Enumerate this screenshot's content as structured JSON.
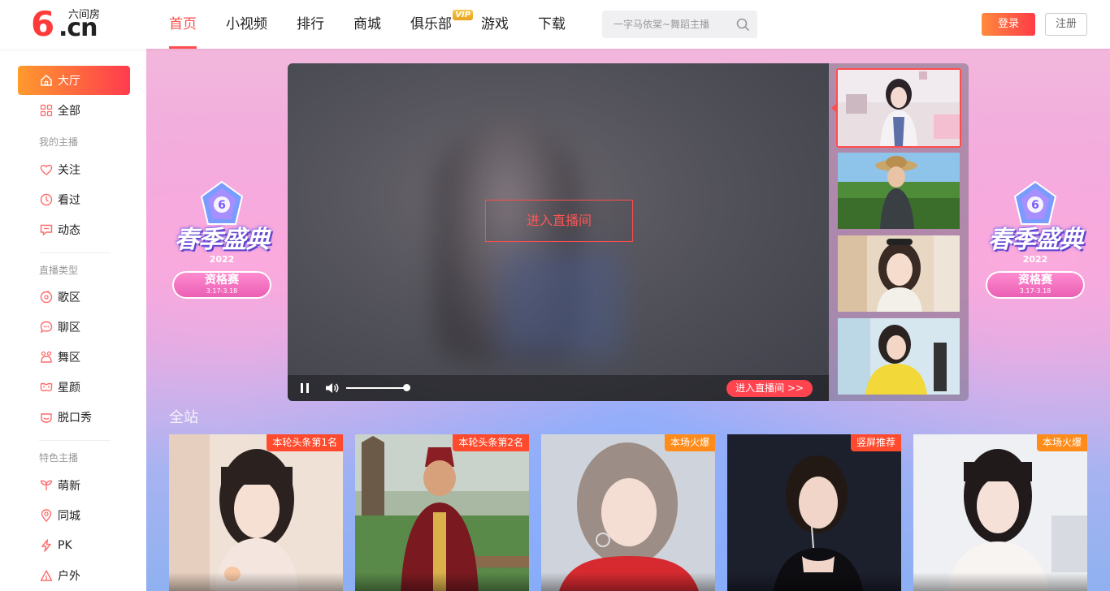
{
  "brand": {
    "logo_text": "6.cn",
    "logo_sub": "六间房",
    "accent": "#ff4d4d"
  },
  "nav": {
    "items": [
      {
        "label": "首页",
        "active": true
      },
      {
        "label": "小视频"
      },
      {
        "label": "排行"
      },
      {
        "label": "商城"
      },
      {
        "label": "俱乐部",
        "badge": "VIP"
      },
      {
        "label": "游戏"
      },
      {
        "label": "下载"
      }
    ]
  },
  "search": {
    "placeholder": "一字马依棠~舞蹈主播"
  },
  "auth": {
    "login": "登录",
    "register": "注册"
  },
  "sidebar": {
    "items": [
      {
        "label": "大厅",
        "icon": "home-icon",
        "active": true
      },
      {
        "label": "全部",
        "icon": "grid-icon"
      }
    ],
    "groups": [
      {
        "title": "我的主播",
        "items": [
          {
            "label": "关注",
            "icon": "heart-icon"
          },
          {
            "label": "看过",
            "icon": "clock-icon"
          },
          {
            "label": "动态",
            "icon": "message-icon"
          }
        ]
      },
      {
        "title": "直播类型",
        "items": [
          {
            "label": "歌区",
            "icon": "music-icon"
          },
          {
            "label": "聊区",
            "icon": "chat-icon"
          },
          {
            "label": "舞区",
            "icon": "dance-icon"
          },
          {
            "label": "星颜",
            "icon": "mask-icon"
          },
          {
            "label": "脱口秀",
            "icon": "smile-icon"
          }
        ]
      },
      {
        "title": "特色主播",
        "items": [
          {
            "label": "萌新",
            "icon": "sprout-icon"
          },
          {
            "label": "同城",
            "icon": "location-icon"
          },
          {
            "label": "PK",
            "icon": "lightning-icon"
          },
          {
            "label": "户外",
            "icon": "outdoor-icon"
          }
        ]
      }
    ]
  },
  "banner": {
    "badge_title": "春季盛典",
    "badge_year": "2022",
    "badge_pill": "资格赛",
    "badge_date": "3.17-3.18"
  },
  "player": {
    "enter_label": "进入直播间",
    "enter_small_label": "进入直播间 >>"
  },
  "section": {
    "title": "全站"
  },
  "cards": [
    {
      "tag": "本轮头条第1名",
      "tag_color": "#ff4a2d"
    },
    {
      "tag": "本轮头条第2名",
      "tag_color": "#ff4a2d"
    },
    {
      "tag": "本场火爆",
      "tag_color": "#ff8c1a"
    },
    {
      "tag": "竖屏推荐",
      "tag_color": "#ff4a2d"
    },
    {
      "tag": "本场火爆",
      "tag_color": "#ff8c1a"
    }
  ]
}
